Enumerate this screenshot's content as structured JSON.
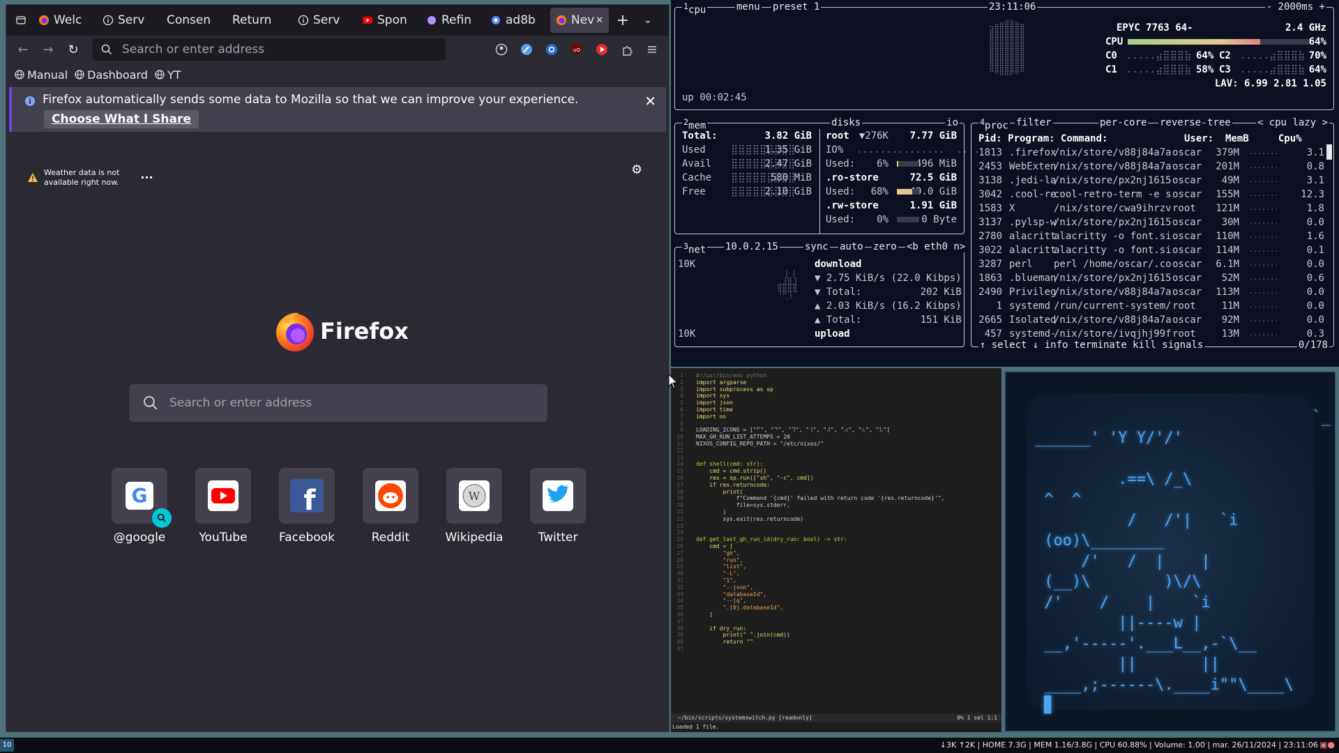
{
  "browser": {
    "tabs": [
      {
        "label": "Welc",
        "icon": "firefox-icon"
      },
      {
        "label": "Serv",
        "icon": "info-icon"
      },
      {
        "label": "Consen",
        "icon": ""
      },
      {
        "label": "Return",
        "icon": ""
      },
      {
        "label": "Serv",
        "icon": "info-icon"
      },
      {
        "label": "Spon",
        "icon": "youtube-icon"
      },
      {
        "label": "Refin",
        "icon": "github-icon"
      },
      {
        "label": "ad8b",
        "icon": "circle-icon"
      },
      {
        "label": "Nev",
        "icon": "firefox-icon",
        "active": true
      }
    ],
    "url_placeholder": "Search or enter address",
    "bookmarks": [
      "Manual",
      "Dashboard",
      "YT"
    ],
    "notice": {
      "message": "Firefox automatically sends some data to Mozilla so that we can improve your experience.",
      "button": "Choose What I Share"
    },
    "weather_line1": "Weather data is not",
    "weather_line2": "available right now.",
    "logo_text": "Firefox",
    "search_placeholder": "Search or enter address",
    "tiles": [
      {
        "label": "@google",
        "icon": "google-icon"
      },
      {
        "label": "YouTube",
        "icon": "youtube-icon"
      },
      {
        "label": "Facebook",
        "icon": "facebook-icon"
      },
      {
        "label": "Reddit",
        "icon": "reddit-icon"
      },
      {
        "label": "Wikipedia",
        "icon": "wikipedia-icon"
      },
      {
        "label": "Twitter",
        "icon": "twitter-icon"
      }
    ]
  },
  "btop": {
    "cpu_title": "cpu",
    "menu": "menu",
    "preset": "preset 1",
    "clock": "23:11:06",
    "interval": "- 2000ms +",
    "cpu_model": "EPYC 7763 64-",
    "freq": "2.4 GHz",
    "cpu_label": "CPU",
    "cpu_total": "64%",
    "cores": [
      {
        "name": "C0",
        "pct": "64%"
      },
      {
        "name": "C2",
        "pct": "70%"
      },
      {
        "name": "C1",
        "pct": "58%"
      },
      {
        "name": "C3",
        "pct": "64%"
      }
    ],
    "lav": "LAV: 6.99 2.81 1.05",
    "uptime": "up 00:02:45",
    "mem_title": "mem",
    "disks_title": "disks",
    "io_title": "io",
    "mem": [
      {
        "label": "Total:",
        "value": "3.82 GiB"
      },
      {
        "label": "Used",
        "value": "1.35 GiB"
      },
      {
        "label": "Avail",
        "value": "2.47 GiB"
      },
      {
        "label": "Cache",
        "value": "580 MiB"
      },
      {
        "label": "Free",
        "value": "2.10 GiB"
      }
    ],
    "disks": [
      {
        "a": "root",
        "b": "▼276K",
        "c": "7.77 GiB",
        "bold": true
      },
      {
        "a": "IO%",
        "b": "",
        "c": ""
      },
      {
        "a": "Used:",
        "b": "6%",
        "c": "496 MiB"
      },
      {
        "a": ".ro-store",
        "b": "",
        "c": "72.5 GiB",
        "bold": true
      },
      {
        "a": "Used:",
        "b": "68%",
        "c": "49.0 GiB"
      },
      {
        "a": ".rw-store",
        "b": "",
        "c": "1.91 GiB",
        "bold": true
      },
      {
        "a": "Used:",
        "b": "0%",
        "c": "0 Byte"
      }
    ],
    "net_title": "net",
    "net_ip": "10.0.2.15",
    "net_opts": [
      "sync",
      "auto",
      "zero",
      "<b eth0 n>"
    ],
    "net_scale_top": "10K",
    "net_scale_bottom": "10K",
    "net": [
      "download",
      "▼ 2.75 KiB/s (22.0 Kibps)",
      "▼ Total:          202 KiB",
      "▲ 2.03 KiB/s (16.2 Kibps)",
      "▲ Total:          151 KiB",
      "upload"
    ],
    "proc_title": "proc",
    "proc_opts": [
      "filter",
      "per-core",
      "reverse",
      "tree",
      "< cpu lazy >"
    ],
    "proc_header": "Pid: Program: Command:             User:  MemB     Cpu%",
    "procs": [
      {
        "pid": "1813",
        "prog": ".firefox",
        "cmd": "/nix/store/v88j84a7a",
        "user": "oscar",
        "mem": "379M",
        "cpu": "3.1"
      },
      {
        "pid": "2453",
        "prog": "WebExten",
        "cmd": "/nix/store/v88j84a7a",
        "user": "oscar",
        "mem": "201M",
        "cpu": "0.8"
      },
      {
        "pid": "3138",
        "prog": ".jedi-la",
        "cmd": "/nix/store/px2nj1615",
        "user": "oscar",
        "mem": "49M",
        "cpu": "3.1"
      },
      {
        "pid": "3042",
        "prog": ".cool-re",
        "cmd": "cool-retro-term -e s",
        "user": "oscar",
        "mem": "155M",
        "cpu": "12.3"
      },
      {
        "pid": "1583",
        "prog": "X",
        "cmd": "/nix/store/cwa9ihrzv",
        "user": "root",
        "mem": "121M",
        "cpu": "1.8"
      },
      {
        "pid": "3137",
        "prog": ".pylsp-w",
        "cmd": "/nix/store/px2nj1615",
        "user": "oscar",
        "mem": "30M",
        "cpu": "0.0"
      },
      {
        "pid": "2780",
        "prog": "alacritt",
        "cmd": "alacritty -o font.si",
        "user": "oscar",
        "mem": "110M",
        "cpu": "1.6"
      },
      {
        "pid": "3022",
        "prog": "alacritt",
        "cmd": "alacritty -o font.si",
        "user": "oscar",
        "mem": "114M",
        "cpu": "0.1"
      },
      {
        "pid": "3287",
        "prog": "perl",
        "cmd": "perl /home/oscar/.co",
        "user": "oscar",
        "mem": "6.1M",
        "cpu": "0.0"
      },
      {
        "pid": "1863",
        "prog": ".blueman",
        "cmd": "/nix/store/px2nj1615",
        "user": "oscar",
        "mem": "52M",
        "cpu": "0.6"
      },
      {
        "pid": "2490",
        "prog": "Privileg",
        "cmd": "/nix/store/v88j84a7a",
        "user": "oscar",
        "mem": "113M",
        "cpu": "0.0"
      },
      {
        "pid": "1",
        "prog": "systemd",
        "cmd": "/run/current-system/",
        "user": "root",
        "mem": "11M",
        "cpu": "0.0"
      },
      {
        "pid": "2665",
        "prog": "Isolated",
        "cmd": "/nix/store/v88j84a7a",
        "user": "oscar",
        "mem": "92M",
        "cpu": "0.0"
      },
      {
        "pid": "457",
        "prog": "systemd-",
        "cmd": "/nix/store/ivqjhj99f",
        "user": "root",
        "mem": "13M",
        "cpu": "0.3"
      }
    ],
    "proc_footer": "↑ select ↓  info   terminate  kill  signals",
    "proc_count": "0/178"
  },
  "editor": {
    "lines": [
      "#!/usr/bin/env python",
      "import argparse",
      "import subprocess as sp",
      "import sys",
      "import json",
      "import time",
      "import os",
      "",
      "LOADING_ICONS = [\"⠋\", \"⠙\", \"⠹\", \"⠸\", \"⠼\", \"⠴\", \"⠦\", \"⠧\"]",
      "MAX_GH_RUN_LIST_ATTEMPS = 20",
      "NIXOS_CONFIG_REPO_PATH = \"/etc/nixos/\"",
      "",
      "",
      "def shell(cmd: str):",
      "    cmd = cmd.strip()",
      "    res = sp.run([\"sh\", \"-c\", cmd])",
      "    if res.returncode:",
      "        print(",
      "            f\"Command '{cmd}' failed with return code '{res.returncode}'\",",
      "            file=sys.stderr,",
      "        )",
      "        sys.exit(res.returncode)",
      "",
      "",
      "def get_last_gh_run_id(dry_run: bool) -> str:",
      "    cmd = [",
      "        \"gh\",",
      "        \"run\",",
      "        \"list\",",
      "        \"-L\",",
      "        \"1\",",
      "        \"--json\",",
      "        \"databaseId\",",
      "        \"--jq\",",
      "        \".[0].databaseId\",",
      "    ]",
      "",
      "    if dry_run:",
      "        print(\" \".join(cmd))",
      "        return \"\"",
      ""
    ],
    "status_file": "~/bin/scripts/systemswitch.py  [readonly]",
    "status_pos": "0%   1 sel  1:1",
    "message": "Loaded 1 file."
  },
  "crt": {
    "art": "                              `_\n______' 'Y Y/'/'\n\n         .==\\ /_\\\n ^  ^\n          /   /'|   `i\n (oo)\\________\n     /'   /  |    |\n (__)\\        )\\/\\\n /'    /    |    `i\n         ||----w |\n __,'-----'.___L__,-`\\__\n         ||       ||\n ____,;------\\.____i\"\"\\____\\\n ▊"
  },
  "status": {
    "workspace": "10",
    "right": "↓3K ↑2K | HOME 7.3G | MEM 1.16/3.8G | CPU 60.88% | Volume: 1.00 | mar. 26/11/2024 | 23:11:06"
  }
}
